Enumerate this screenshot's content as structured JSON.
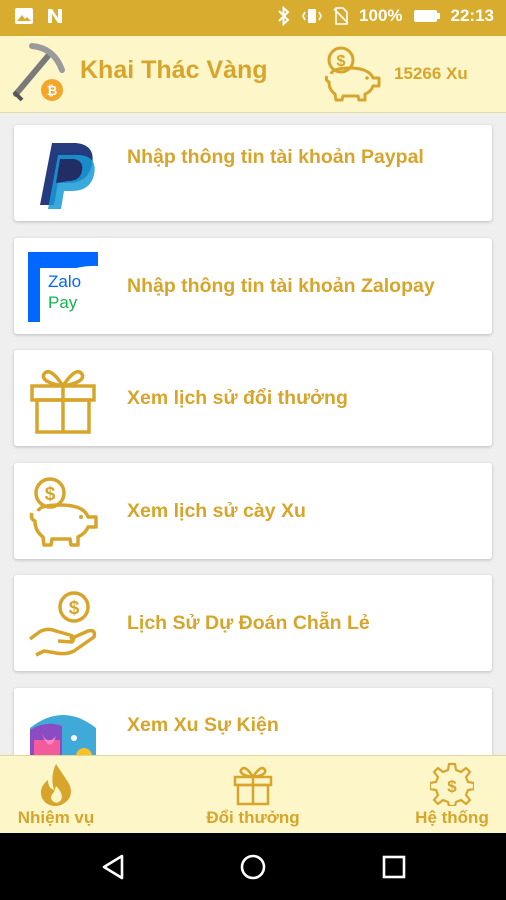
{
  "status_bar": {
    "battery": "100%",
    "time": "22:13"
  },
  "header": {
    "title": "Khai Thác Vàng",
    "coins": "15266 Xu"
  },
  "menu": [
    {
      "label": "Nhập thông tin tài khoản Paypal",
      "icon": "paypal-icon"
    },
    {
      "label": "Nhập thông tin tài khoản Zalopay",
      "icon": "zalopay-icon"
    },
    {
      "label": "Xem lịch sử đổi thưởng",
      "icon": "gift-icon"
    },
    {
      "label": "Xem lịch sử cày Xu",
      "icon": "piggy-bank-icon"
    },
    {
      "label": "Lịch Sử Dự Đoán Chẵn Lẻ",
      "icon": "coin-hand-icon"
    },
    {
      "label": "Xem Xu Sự Kiện",
      "icon": "event-gift-icon"
    }
  ],
  "zalopay_logo": {
    "line1": "Zalo",
    "line2": "Pay"
  },
  "bottom_nav": [
    {
      "label": "Nhiệm vụ",
      "icon": "fire-icon"
    },
    {
      "label": "Đổi thưởng",
      "icon": "gift-icon"
    },
    {
      "label": "Hệ thống",
      "icon": "gear-icon"
    }
  ],
  "colors": {
    "status_bar": "#d8ad2f",
    "accent": "#d7a52b",
    "appbar_bg": "#fcf6c9",
    "paypal_dark": "#253b80",
    "paypal_light": "#179bd7",
    "zalopay_blue": "#0068ff",
    "zalopay_green": "#0fb64c"
  }
}
